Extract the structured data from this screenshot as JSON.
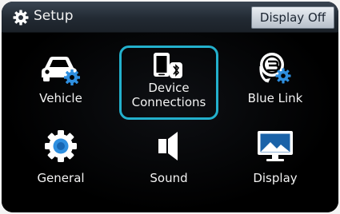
{
  "header": {
    "title": "Setup",
    "display_off_label": "Display Off"
  },
  "menu": {
    "vehicle": "Vehicle",
    "device_connections_line1": "Device",
    "device_connections_line2": "Connections",
    "blue_link": "Blue Link",
    "general": "General",
    "sound": "Sound",
    "display": "Display"
  },
  "colors": {
    "selection": "#23b0cc",
    "accent": "#2e8fe0",
    "header": "#2a323c"
  }
}
